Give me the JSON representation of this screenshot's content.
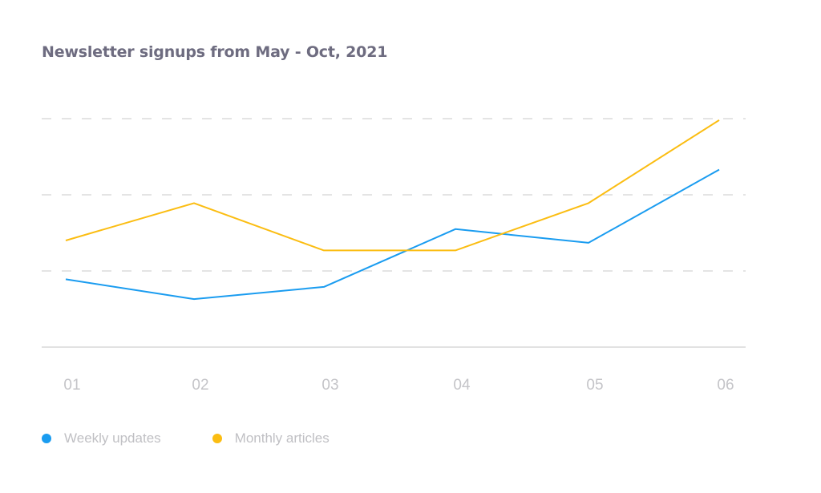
{
  "chart_data": {
    "type": "line",
    "title": "Newsletter signups from May - Oct, 2021",
    "xlabel": "",
    "ylabel": "",
    "categories": [
      "01",
      "02",
      "03",
      "04",
      "05",
      "06"
    ],
    "ylim": [
      0,
      3
    ],
    "yticks": [
      1,
      2,
      3
    ],
    "ytick_labels_shown": false,
    "grid": "horizontal-dashed",
    "legend_position": "bottom-left",
    "series": [
      {
        "name": "Weekly updates",
        "color": "#1a9cf0",
        "values": [
          0.89,
          0.63,
          0.79,
          1.55,
          1.37,
          2.33
        ]
      },
      {
        "name": "Monthly articles",
        "color": "#fbbd12",
        "values": [
          1.4,
          1.89,
          1.27,
          1.27,
          1.89,
          2.98
        ]
      }
    ]
  }
}
